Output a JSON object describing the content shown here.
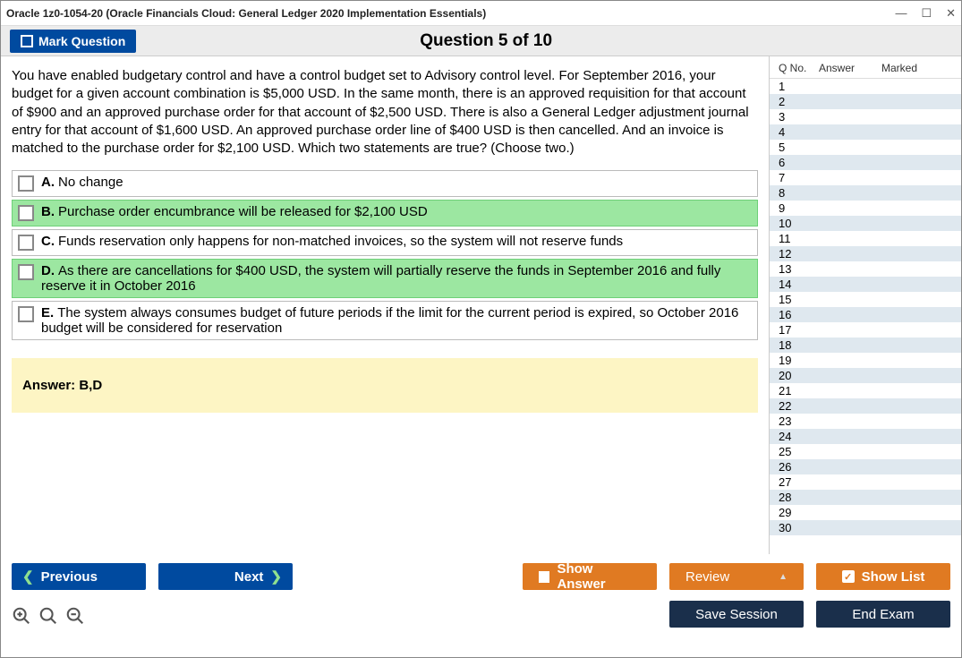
{
  "window": {
    "title": "Oracle 1z0-1054-20 (Oracle Financials Cloud: General Ledger 2020 Implementation Essentials)"
  },
  "header": {
    "mark_label": "Mark Question",
    "question_title": "Question 5 of 10"
  },
  "question": {
    "text": "You have enabled budgetary control and have a control budget set to Advisory control level. For September 2016, your budget for a given account combination is $5,000 USD. In the same month, there is an approved requisition for that account of $900 and an approved purchase order for that account of $2,500 USD. There is also a General Ledger adjustment journal entry for that account of $1,600 USD. An approved purchase order line of $400 USD is then cancelled. And an invoice is matched to the purchase order for $2,100 USD. Which two statements are true? (Choose two.)",
    "options": [
      {
        "letter": "A.",
        "text": "No change",
        "correct": false
      },
      {
        "letter": "B.",
        "text": "Purchase order encumbrance will be released for $2,100 USD",
        "correct": true
      },
      {
        "letter": "C.",
        "text": "Funds reservation only happens for non-matched invoices, so the system will not reserve funds",
        "correct": false
      },
      {
        "letter": "D.",
        "text": "As there are cancellations for $400 USD, the system will partially reserve the funds in September 2016 and fully reserve it in October 2016",
        "correct": true
      },
      {
        "letter": "E.",
        "text": "The system always consumes budget of future periods if the limit for the current period is expired, so October 2016 budget will be considered for reservation",
        "correct": false
      }
    ],
    "answer_label": "Answer: B,D"
  },
  "sidebar": {
    "col_qno": "Q No.",
    "col_answer": "Answer",
    "col_marked": "Marked",
    "rows": 30
  },
  "footer": {
    "previous": "Previous",
    "next": "Next",
    "show_answer": "Show Answer",
    "review": "Review",
    "show_list": "Show List",
    "save_session": "Save Session",
    "end_exam": "End Exam"
  }
}
